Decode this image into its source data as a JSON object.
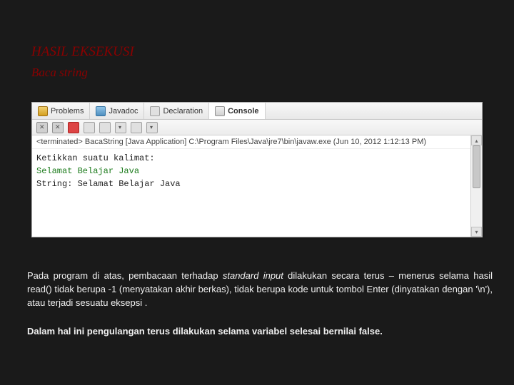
{
  "title": "HASIL EKSEKUSI",
  "subtitle": "Baca string",
  "tabs": {
    "problems": "Problems",
    "javadoc": "Javadoc",
    "declaration": "Declaration",
    "console": "Console"
  },
  "status": "<terminated> BacaString [Java Application] C:\\Program Files\\Java\\jre7\\bin\\javaw.exe (Jun 10, 2012 1:12:13 PM)",
  "console": {
    "prompt": "Ketikkan suatu kalimat:",
    "input": "Selamat Belajar Java",
    "output": "String: Selamat Belajar Java"
  },
  "para1_a": "Pada program di atas, pembacaan terhadap ",
  "para1_b": "standard input",
  "para1_c": " dilakukan secara  terus – menerus selama hasil read() tidak berupa -1 (menyatakan akhir berkas), tidak berupa kode untuk tombol Enter (dinyatakan dengan '\\n'), atau terjadi sesuatu eksepsi .",
  "para2": "Dalam hal ini  pengulangan terus dilakukan selama variabel selesai bernilai false."
}
